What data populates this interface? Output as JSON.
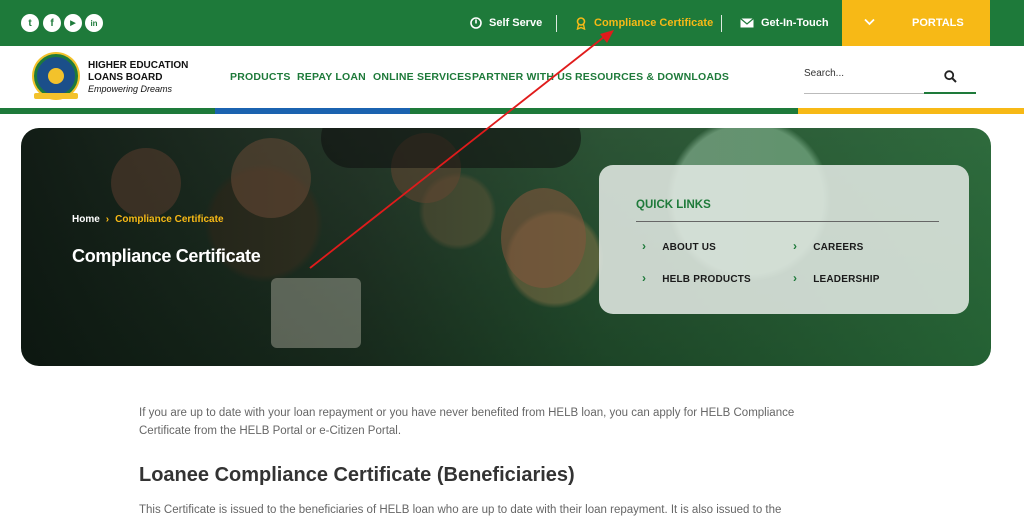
{
  "topbar": {
    "social": [
      {
        "name": "twitter",
        "glyph": "t"
      },
      {
        "name": "facebook",
        "glyph": "f"
      },
      {
        "name": "youtube",
        "glyph": "▶"
      },
      {
        "name": "linkedin",
        "glyph": "in"
      }
    ],
    "self_serve": "Self Serve",
    "compliance": "Compliance Certificate",
    "get_in_touch": "Get-In-Touch",
    "portals": "PORTALS"
  },
  "brand": {
    "line1": "HIGHER EDUCATION",
    "line2": "LOANS BOARD",
    "tagline": "Empowering Dreams"
  },
  "nav": [
    "PRODUCTS",
    "REPAY LOAN",
    "ONLINE SERVICES",
    "PARTNER WITH US",
    "RESOURCES & DOWNLOADS"
  ],
  "search": {
    "placeholder": "Search..."
  },
  "hero": {
    "breadcrumb_home": "Home",
    "breadcrumb_sep": "›",
    "breadcrumb_current": "Compliance Certificate",
    "title": "Compliance Certificate"
  },
  "quick_links": {
    "title": "QUICK LINKS",
    "items": [
      "ABOUT US",
      "CAREERS",
      "HELB PRODUCTS",
      "LEADERSHIP"
    ]
  },
  "content": {
    "intro": "If you are up to date with your loan repayment or you have never benefited from HELB loan, you can apply for HELB Compliance Certificate from the HELB Portal or e-Citizen Portal.",
    "heading": "Loanee Compliance Certificate (Beneficiaries)",
    "para": "This Certificate is issued to the beneficiaries of HELB loan who are up to date with their loan repayment. It is also issued to the"
  },
  "colors": {
    "green": "#1e7a3a",
    "yellow": "#f7b916",
    "blue": "#1b63b0",
    "annotation_arrow": "#e01b1b"
  }
}
